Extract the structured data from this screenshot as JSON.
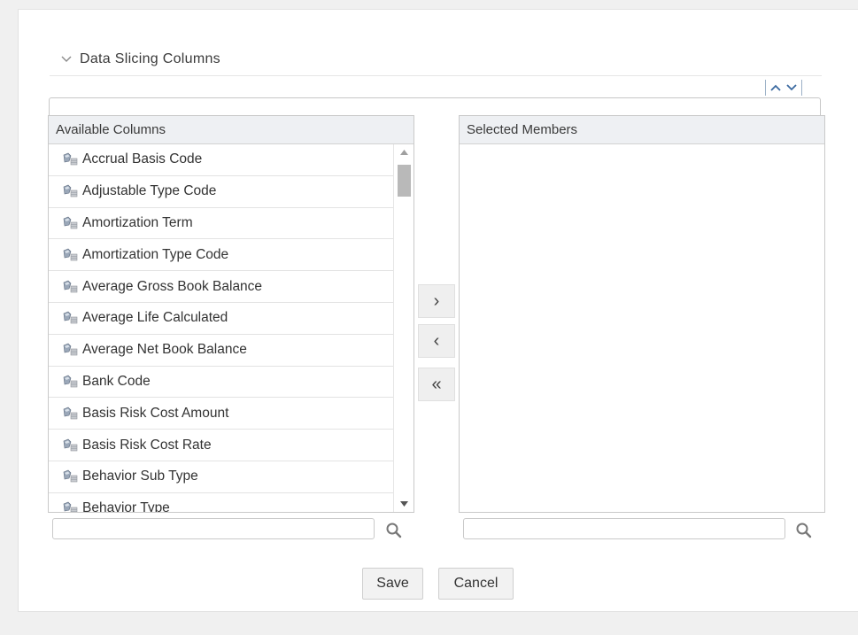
{
  "section": {
    "title": "Data Slicing Columns",
    "collapse_icon": "chevron-down-icon",
    "order_icons": [
      "chevron-up-icon",
      "chevron-down-icon"
    ]
  },
  "available": {
    "header": "Available Columns",
    "items": [
      "Accrual Basis Code",
      "Adjustable Type Code",
      "Amortization Term",
      "Amortization Type Code",
      "Average Gross Book Balance",
      "Average Life Calculated",
      "Average Net Book Balance",
      "Bank Code",
      "Basis Risk Cost Amount",
      "Basis Risk Cost Rate",
      "Behavior Sub Type",
      "Behavior Type"
    ],
    "item_icon": "column-member-icon",
    "search_placeholder": ""
  },
  "selected": {
    "header": "Selected Members",
    "items": [],
    "search_placeholder": ""
  },
  "move_buttons": {
    "add": "›",
    "remove": "‹",
    "remove_all": "«"
  },
  "actions": {
    "save": "Save",
    "cancel": "Cancel"
  }
}
